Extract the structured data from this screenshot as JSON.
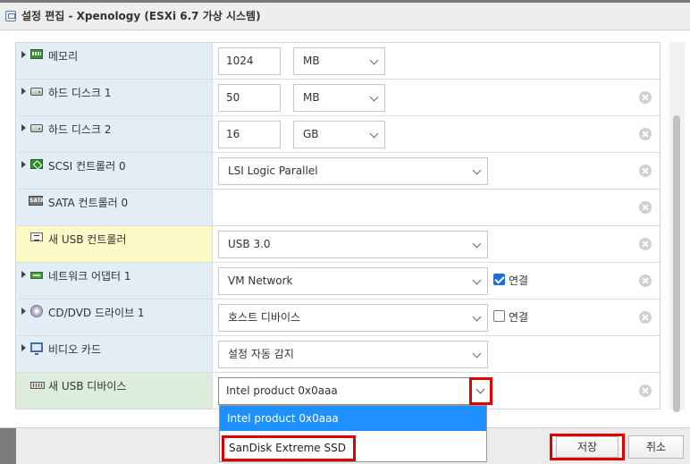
{
  "window": {
    "title": "설정 편집 - Xpenology (ESXi 6.7 가상 시스템)",
    "icon": "vm-settings-icon"
  },
  "devices": [
    {
      "id": "memory",
      "label": "메모리",
      "icon": "memory-icon",
      "expandable": true,
      "value": "1024",
      "unit": "MB",
      "removable": false
    },
    {
      "id": "hdd1",
      "label": "하드 디스크 1",
      "icon": "hard-disk-icon",
      "expandable": true,
      "value": "50",
      "unit": "MB",
      "removable": true
    },
    {
      "id": "hdd2",
      "label": "하드 디스크 2",
      "icon": "hard-disk-icon",
      "expandable": true,
      "value": "16",
      "unit": "GB",
      "removable": true
    },
    {
      "id": "scsi0",
      "label": "SCSI 컨트롤러 0",
      "icon": "scsi-controller-icon",
      "expandable": true,
      "select": "LSI Logic Parallel",
      "removable": true
    },
    {
      "id": "sata0",
      "label": "SATA 컨트롤러 0",
      "icon": "sata-controller-icon",
      "icon_text": "SATA",
      "expandable": false,
      "removable": true
    },
    {
      "id": "usbctl",
      "label": "새 USB 컨트롤러",
      "icon": "usb-controller-icon",
      "expandable": false,
      "select": "USB 3.0",
      "removable": true,
      "highlighted": true
    },
    {
      "id": "nic1",
      "label": "네트워크 어댑터 1",
      "icon": "network-adapter-icon",
      "expandable": true,
      "select": "VM Network",
      "connect_label": "연결",
      "connected": true,
      "removable": true
    },
    {
      "id": "cd1",
      "label": "CD/DVD 드라이브 1",
      "icon": "cd-dvd-icon",
      "expandable": true,
      "select": "호스트 디바이스",
      "connect_label": "연결",
      "connected": false,
      "removable": true
    },
    {
      "id": "video",
      "label": "비디오 카드",
      "icon": "video-card-icon",
      "expandable": true,
      "select": "설정 자동 감지",
      "removable": false
    },
    {
      "id": "usbdev",
      "label": "새 USB 디바이스",
      "icon": "usb-device-icon",
      "expandable": false,
      "select": "Intel product 0x0aaa",
      "removable": true
    }
  ],
  "usb_dropdown": {
    "options": [
      "Intel product 0x0aaa",
      "SanDisk Extreme SSD"
    ],
    "selected": "Intel product 0x0aaa"
  },
  "footer": {
    "save_label": "저장",
    "cancel_label": "취소"
  },
  "colors": {
    "annotation_red": "#e00000",
    "dropdown_selected": "#1e90ff",
    "checkbox_checked": "#1f6fd1"
  }
}
